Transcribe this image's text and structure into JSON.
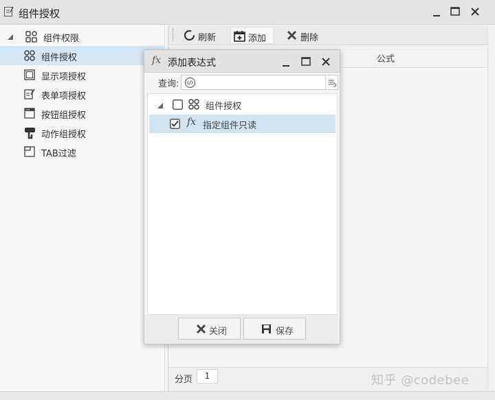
{
  "window": {
    "title": "组件授权"
  },
  "tree": {
    "root_label": "组件权限",
    "items": [
      {
        "label": "组件授权",
        "icon": "component-icon",
        "selected": true
      },
      {
        "label": "显示项授权",
        "icon": "display-item-icon"
      },
      {
        "label": "表单项授权",
        "icon": "form-item-icon"
      },
      {
        "label": "按钮组授权",
        "icon": "button-group-icon"
      },
      {
        "label": "动作组授权",
        "icon": "action-group-icon"
      },
      {
        "label": "TAB过滤",
        "icon": "tab-filter-icon"
      }
    ]
  },
  "toolbar": {
    "refresh_label": "刷新",
    "add_label": "添加",
    "delete_label": "删除"
  },
  "grid": {
    "formula_header": "公式"
  },
  "pager": {
    "label": "分页",
    "page": "1"
  },
  "dialog": {
    "fx_glyph": "fx",
    "title": "添加表达式",
    "query_label": "查询:",
    "query_value": "",
    "tree": {
      "parent_label": "组件授权",
      "parent_checked": false,
      "child_fx": "fx",
      "child_label": "指定组件只读",
      "child_checked": true
    },
    "close_label": "关闭",
    "save_label": "保存"
  },
  "watermark": "知乎 @codebee",
  "colors": {
    "selection": "#d6e6f2",
    "accent_icon": "#444444"
  }
}
